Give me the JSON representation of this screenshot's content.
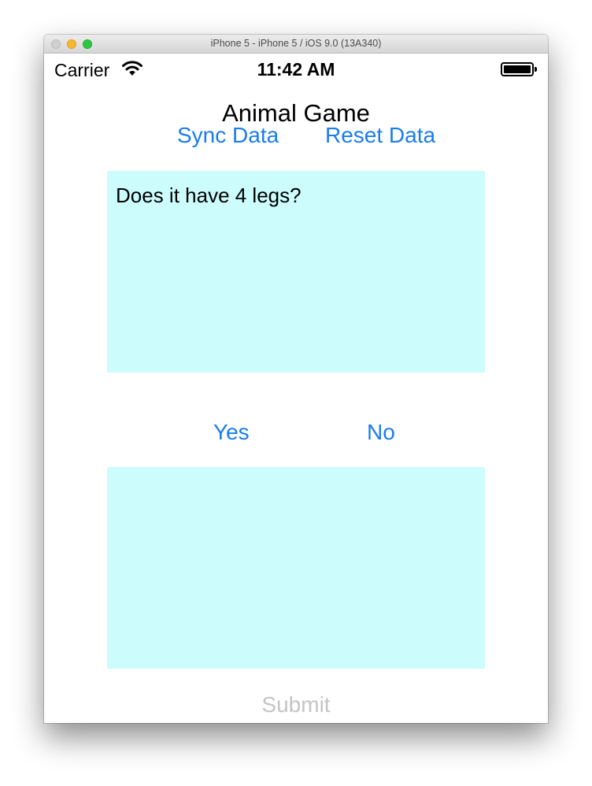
{
  "window": {
    "title": "iPhone 5 - iPhone 5 / iOS 9.0 (13A340)"
  },
  "status_bar": {
    "carrier": "Carrier",
    "time": "11:42 AM",
    "wifi_icon": "wifi-icon",
    "battery_icon": "battery-full-icon"
  },
  "app": {
    "title": "Animal Game",
    "sync_label": "Sync Data",
    "reset_label": "Reset Data",
    "question_text": "Does it have 4 legs?",
    "answer_text": "",
    "yes_label": "Yes",
    "no_label": "No",
    "submit_label": "Submit"
  },
  "colors": {
    "accent": "#1a7cf0",
    "textbox_background": "#ccfcfc",
    "disabled_text": "#c4c4c4"
  }
}
